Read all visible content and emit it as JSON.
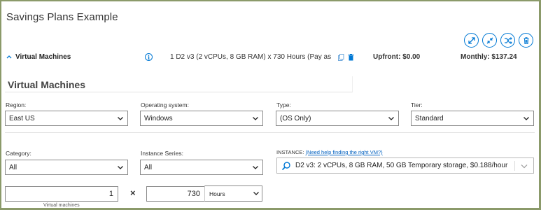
{
  "page": {
    "title": "Savings Plans Example"
  },
  "toolbar": {
    "buttons": [
      {
        "icon": "expand-icon"
      },
      {
        "icon": "collapse-icon"
      },
      {
        "icon": "shuffle-icon"
      },
      {
        "icon": "trash-icon"
      }
    ]
  },
  "summary": {
    "label": "Virtual Machines",
    "description": "1 D2 v3 (2 vCPUs, 8 GB RAM) x 730 Hours (Pay as y...",
    "upfront": "Upfront: $0.00",
    "monthly": "Monthly: $137.24"
  },
  "section": {
    "title": "Virtual Machines"
  },
  "fields": {
    "region": {
      "label": "Region:",
      "value": "East US"
    },
    "os": {
      "label": "Operating system:",
      "value": "Windows"
    },
    "type": {
      "label": "Type:",
      "value": "(OS Only)"
    },
    "tier": {
      "label": "Tier:",
      "value": "Standard"
    },
    "category": {
      "label": "Category:",
      "value": "All"
    },
    "series": {
      "label": "Instance Series:",
      "value": "All"
    },
    "instance": {
      "label": "INSTANCE:",
      "help_link": "(Need help finding the right VM?)",
      "value": "D2 v3: 2 vCPUs, 8 GB RAM, 50 GB Temporary storage, $0.188/hour"
    }
  },
  "quantity": {
    "vm_count": "1",
    "vm_caption": "Virtual machines",
    "times_symbol": "×",
    "hours": "730",
    "hours_unit": "Hours"
  },
  "colors": {
    "accent": "#0078d4",
    "frame": "#8b9a6a"
  }
}
